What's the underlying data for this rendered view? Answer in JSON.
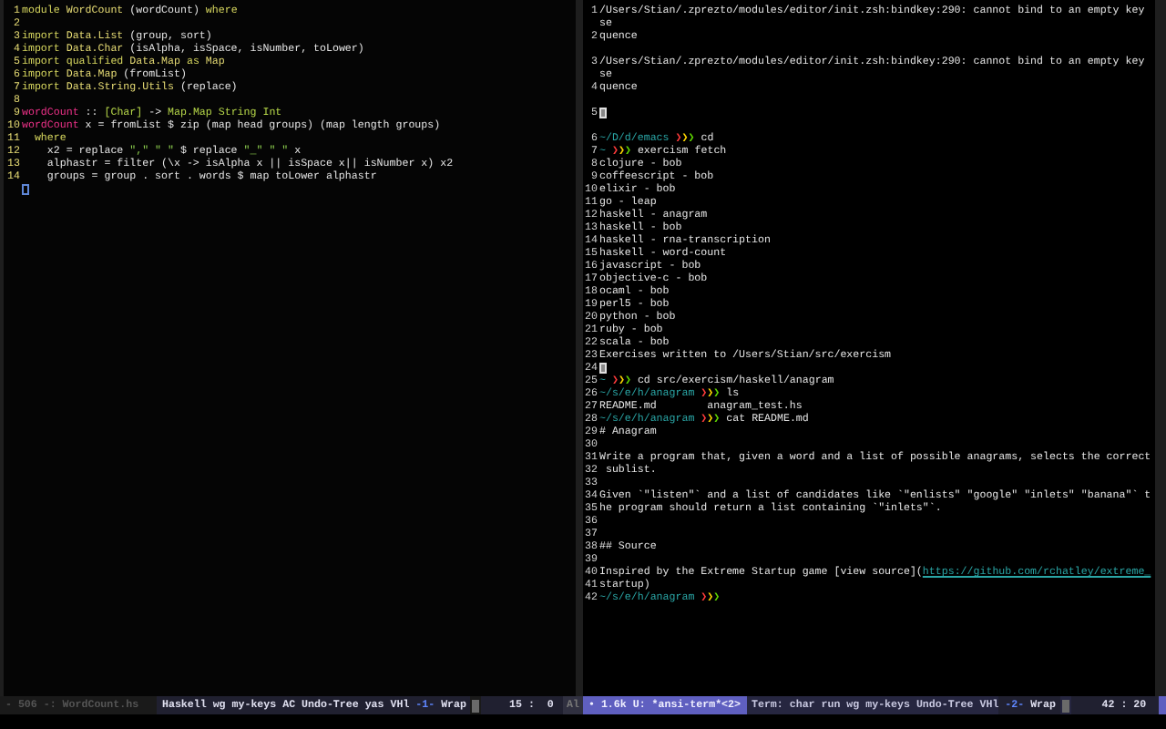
{
  "editor_pane": {
    "rows": [
      {
        "kind": "line",
        "number": "1",
        "segments": [
          {
            "kind": "keyword",
            "text": "module"
          },
          {
            "kind": "module",
            "text": " WordCount"
          },
          {
            "kind": "plain",
            "text": " (wordCount)"
          },
          {
            "kind": "keyword",
            "text": " where"
          }
        ]
      },
      {
        "kind": "line",
        "number": "2"
      },
      {
        "kind": "line",
        "number": "3",
        "segments": [
          {
            "kind": "keyword",
            "text": "import"
          },
          {
            "kind": "module",
            "text": " Data.List"
          },
          {
            "kind": "plain",
            "text": " (group, sort)"
          }
        ]
      },
      {
        "kind": "line",
        "number": "4",
        "segments": [
          {
            "kind": "keyword",
            "text": "import"
          },
          {
            "kind": "module",
            "text": " Data.Char"
          },
          {
            "kind": "plain",
            "text": " (isAlpha, isSpace, isNumber, toLower)"
          }
        ]
      },
      {
        "kind": "line",
        "number": "5",
        "segments": [
          {
            "kind": "keyword",
            "text": "import"
          },
          {
            "kind": "keyword",
            "text": " qualified"
          },
          {
            "kind": "module",
            "text": " Data.Map"
          },
          {
            "kind": "keyword",
            "text": " as"
          },
          {
            "kind": "module",
            "text": " Map"
          }
        ]
      },
      {
        "kind": "line",
        "number": "6",
        "segments": [
          {
            "kind": "keyword",
            "text": "import"
          },
          {
            "kind": "module",
            "text": " Data.Map"
          },
          {
            "kind": "plain",
            "text": " (fromList)"
          }
        ]
      },
      {
        "kind": "line",
        "number": "7",
        "segments": [
          {
            "kind": "keyword",
            "text": "import"
          },
          {
            "kind": "module",
            "text": " Data.String.Utils"
          },
          {
            "kind": "plain",
            "text": " (replace)"
          }
        ]
      },
      {
        "kind": "line",
        "number": "8"
      },
      {
        "kind": "line",
        "number": "9",
        "segments": [
          {
            "kind": "function",
            "text": "wordCount"
          },
          {
            "kind": "plain",
            "text": " :: "
          },
          {
            "kind": "type",
            "text": "[Char]"
          },
          {
            "kind": "plain",
            "text": " -> "
          },
          {
            "kind": "type",
            "text": "Map.Map String Int"
          }
        ]
      },
      {
        "kind": "line",
        "number": "10",
        "segments": [
          {
            "kind": "function",
            "text": "wordCount"
          },
          {
            "kind": "plain",
            "text": " x = fromList $ zip (map head groups) (map length groups)"
          }
        ]
      },
      {
        "kind": "line",
        "number": "11",
        "segments": [
          {
            "kind": "keyword",
            "text": "  where"
          }
        ]
      },
      {
        "kind": "line",
        "number": "12",
        "segments": [
          {
            "kind": "plain",
            "text": "    x2 = replace "
          },
          {
            "kind": "string",
            "text": "\",\""
          },
          {
            "kind": "string",
            "text": " \" \""
          },
          {
            "kind": "plain",
            "text": " $ replace "
          },
          {
            "kind": "string",
            "text": "\"_\""
          },
          {
            "kind": "string",
            "text": " \" \""
          },
          {
            "kind": "plain",
            "text": " x"
          }
        ]
      },
      {
        "kind": "line",
        "number": "13",
        "segments": [
          {
            "kind": "plain",
            "text": "    alphastr = filter (\\x -> isAlpha x || isSpace x|| isNumber x) x2"
          }
        ]
      },
      {
        "kind": "line",
        "number": "14",
        "segments": [
          {
            "kind": "plain",
            "text": "    groups = group . sort . words $ map toLower alphastr"
          }
        ]
      },
      {
        "kind": "cursor"
      }
    ]
  },
  "terminal_pane": {
    "rows": [
      {
        "kind": "line",
        "number": "1",
        "segments": [
          {
            "kind": "plain",
            "text": "/Users/Stian/.zprezto/modules/editor/init.zsh:bindkey:290: cannot bind to an empty key"
          }
        ]
      },
      {
        "kind": "line",
        "segments": [
          {
            "kind": "plain",
            "text": "se"
          }
        ]
      },
      {
        "kind": "line",
        "number": "2",
        "segments": [
          {
            "kind": "plain",
            "text": "quence"
          }
        ]
      },
      {
        "kind": "spacer"
      },
      {
        "kind": "line",
        "number": "3",
        "segments": [
          {
            "kind": "plain",
            "text": "/Users/Stian/.zprezto/modules/editor/init.zsh:bindkey:290: cannot bind to an empty key"
          }
        ]
      },
      {
        "kind": "line",
        "segments": [
          {
            "kind": "plain",
            "text": "se"
          }
        ]
      },
      {
        "kind": "line",
        "number": "4",
        "segments": [
          {
            "kind": "plain",
            "text": "quence"
          }
        ]
      },
      {
        "kind": "spacer"
      },
      {
        "kind": "cursor",
        "number": "5"
      },
      {
        "kind": "spacer"
      },
      {
        "kind": "line",
        "number": "6",
        "segments": [
          {
            "kind": "path",
            "text": "~/D/d/emacs "
          },
          {
            "kind": "arrow_red",
            "text": "❯"
          },
          {
            "kind": "arrow_yellow",
            "text": "❯"
          },
          {
            "kind": "arrow_green",
            "text": "❯"
          },
          {
            "kind": "plain",
            "text": " cd"
          }
        ]
      },
      {
        "kind": "line",
        "number": "7",
        "segments": [
          {
            "kind": "path",
            "text": "~ "
          },
          {
            "kind": "arrow_red",
            "text": "❯"
          },
          {
            "kind": "arrow_yellow",
            "text": "❯"
          },
          {
            "kind": "arrow_green",
            "text": "❯"
          },
          {
            "kind": "plain",
            "text": " exercism fetch"
          }
        ]
      },
      {
        "kind": "line",
        "number": "8",
        "segments": [
          {
            "kind": "plain",
            "text": "clojure - bob"
          }
        ]
      },
      {
        "kind": "line",
        "number": "9",
        "segments": [
          {
            "kind": "plain",
            "text": "coffeescript - bob"
          }
        ]
      },
      {
        "kind": "line",
        "number": "10",
        "segments": [
          {
            "kind": "plain",
            "text": "elixir - bob"
          }
        ]
      },
      {
        "kind": "line",
        "number": "11",
        "segments": [
          {
            "kind": "plain",
            "text": "go - leap"
          }
        ]
      },
      {
        "kind": "line",
        "number": "12",
        "segments": [
          {
            "kind": "plain",
            "text": "haskell - anagram"
          }
        ]
      },
      {
        "kind": "line",
        "number": "13",
        "segments": [
          {
            "kind": "plain",
            "text": "haskell - bob"
          }
        ]
      },
      {
        "kind": "line",
        "number": "14",
        "segments": [
          {
            "kind": "plain",
            "text": "haskell - rna-transcription"
          }
        ]
      },
      {
        "kind": "line",
        "number": "15",
        "segments": [
          {
            "kind": "plain",
            "text": "haskell - word-count"
          }
        ]
      },
      {
        "kind": "line",
        "number": "16",
        "segments": [
          {
            "kind": "plain",
            "text": "javascript - bob"
          }
        ]
      },
      {
        "kind": "line",
        "number": "17",
        "segments": [
          {
            "kind": "plain",
            "text": "objective-c - bob"
          }
        ]
      },
      {
        "kind": "line",
        "number": "18",
        "segments": [
          {
            "kind": "plain",
            "text": "ocaml - bob"
          }
        ]
      },
      {
        "kind": "line",
        "number": "19",
        "segments": [
          {
            "kind": "plain",
            "text": "perl5 - bob"
          }
        ]
      },
      {
        "kind": "line",
        "number": "20",
        "segments": [
          {
            "kind": "plain",
            "text": "python - bob"
          }
        ]
      },
      {
        "kind": "line",
        "number": "21",
        "segments": [
          {
            "kind": "plain",
            "text": "ruby - bob"
          }
        ]
      },
      {
        "kind": "line",
        "number": "22",
        "segments": [
          {
            "kind": "plain",
            "text": "scala - bob"
          }
        ]
      },
      {
        "kind": "line",
        "number": "23",
        "segments": [
          {
            "kind": "plain",
            "text": "Exercises written to /Users/Stian/src/exercism"
          }
        ]
      },
      {
        "kind": "cursor",
        "number": "24"
      },
      {
        "kind": "line",
        "number": "25",
        "segments": [
          {
            "kind": "path",
            "text": "~ "
          },
          {
            "kind": "arrow_red",
            "text": "❯"
          },
          {
            "kind": "arrow_yellow",
            "text": "❯"
          },
          {
            "kind": "arrow_green",
            "text": "❯"
          },
          {
            "kind": "plain",
            "text": " cd src/exercism/haskell/anagram"
          }
        ]
      },
      {
        "kind": "line",
        "number": "26",
        "segments": [
          {
            "kind": "path",
            "text": "~/s/e/h/anagram "
          },
          {
            "kind": "arrow_red",
            "text": "❯"
          },
          {
            "kind": "arrow_yellow",
            "text": "❯"
          },
          {
            "kind": "arrow_green",
            "text": "❯"
          },
          {
            "kind": "plain",
            "text": " ls"
          }
        ]
      },
      {
        "kind": "line",
        "number": "27",
        "segments": [
          {
            "kind": "plain",
            "text": "README.md        anagram_test.hs"
          }
        ]
      },
      {
        "kind": "line",
        "number": "28",
        "segments": [
          {
            "kind": "path",
            "text": "~/s/e/h/anagram "
          },
          {
            "kind": "arrow_red",
            "text": "❯"
          },
          {
            "kind": "arrow_yellow",
            "text": "❯"
          },
          {
            "kind": "arrow_green",
            "text": "❯"
          },
          {
            "kind": "plain",
            "text": " cat README.md"
          }
        ]
      },
      {
        "kind": "line",
        "number": "29",
        "segments": [
          {
            "kind": "plain",
            "text": "# Anagram"
          }
        ]
      },
      {
        "kind": "line",
        "number": "30"
      },
      {
        "kind": "line",
        "number": "31",
        "segments": [
          {
            "kind": "plain",
            "text": "Write a program that, given a word and a list of possible anagrams, selects the correct"
          }
        ]
      },
      {
        "kind": "line",
        "number": "32",
        "segments": [
          {
            "kind": "plain",
            "text": " sublist."
          }
        ]
      },
      {
        "kind": "line",
        "number": "33"
      },
      {
        "kind": "line",
        "number": "34",
        "segments": [
          {
            "kind": "plain",
            "text": "Given `\"listen\"` and a list of candidates like `\"enlists\" \"google\" \"inlets\" \"banana\"` t"
          }
        ]
      },
      {
        "kind": "line",
        "number": "35",
        "segments": [
          {
            "kind": "plain",
            "text": "he program should return a list containing `\"inlets\"`."
          }
        ]
      },
      {
        "kind": "line",
        "number": "36"
      },
      {
        "kind": "line",
        "number": "37"
      },
      {
        "kind": "line",
        "number": "38",
        "segments": [
          {
            "kind": "plain",
            "text": "## Source"
          }
        ]
      },
      {
        "kind": "line",
        "number": "39"
      },
      {
        "kind": "line",
        "number": "40",
        "segments": [
          {
            "kind": "plain",
            "text": "Inspired by the Extreme Startup game [view source]("
          },
          {
            "kind": "link",
            "text": "https://github.com/rchatley/extreme_"
          }
        ]
      },
      {
        "kind": "line",
        "number": "41",
        "segments": [
          {
            "kind": "plain",
            "text": "startup)"
          }
        ]
      },
      {
        "kind": "line",
        "number": "42",
        "segments": [
          {
            "kind": "path",
            "text": "~/s/e/h/anagram "
          },
          {
            "kind": "arrow_red",
            "text": "❯"
          },
          {
            "kind": "arrow_yellow",
            "text": "❯"
          },
          {
            "kind": "arrow_green",
            "text": "❯"
          }
        ]
      }
    ]
  },
  "mode_lines": [
    {
      "active": false,
      "buffer": "- 506 -: WordCount.hs",
      "modes": "Haskell wg my-keys AC Undo-Tree yas VHl",
      "window_number": "-1-",
      "wrap": "Wrap",
      "position": "15 :  0",
      "extra": "Al"
    },
    {
      "active": true,
      "buffer": "• 1.6k U: *ansi-term*<2>",
      "modes": "Term: char run wg my-keys Undo-Tree VHl",
      "window_number": "-2-",
      "wrap": "Wrap",
      "position": "42 : 20"
    }
  ]
}
